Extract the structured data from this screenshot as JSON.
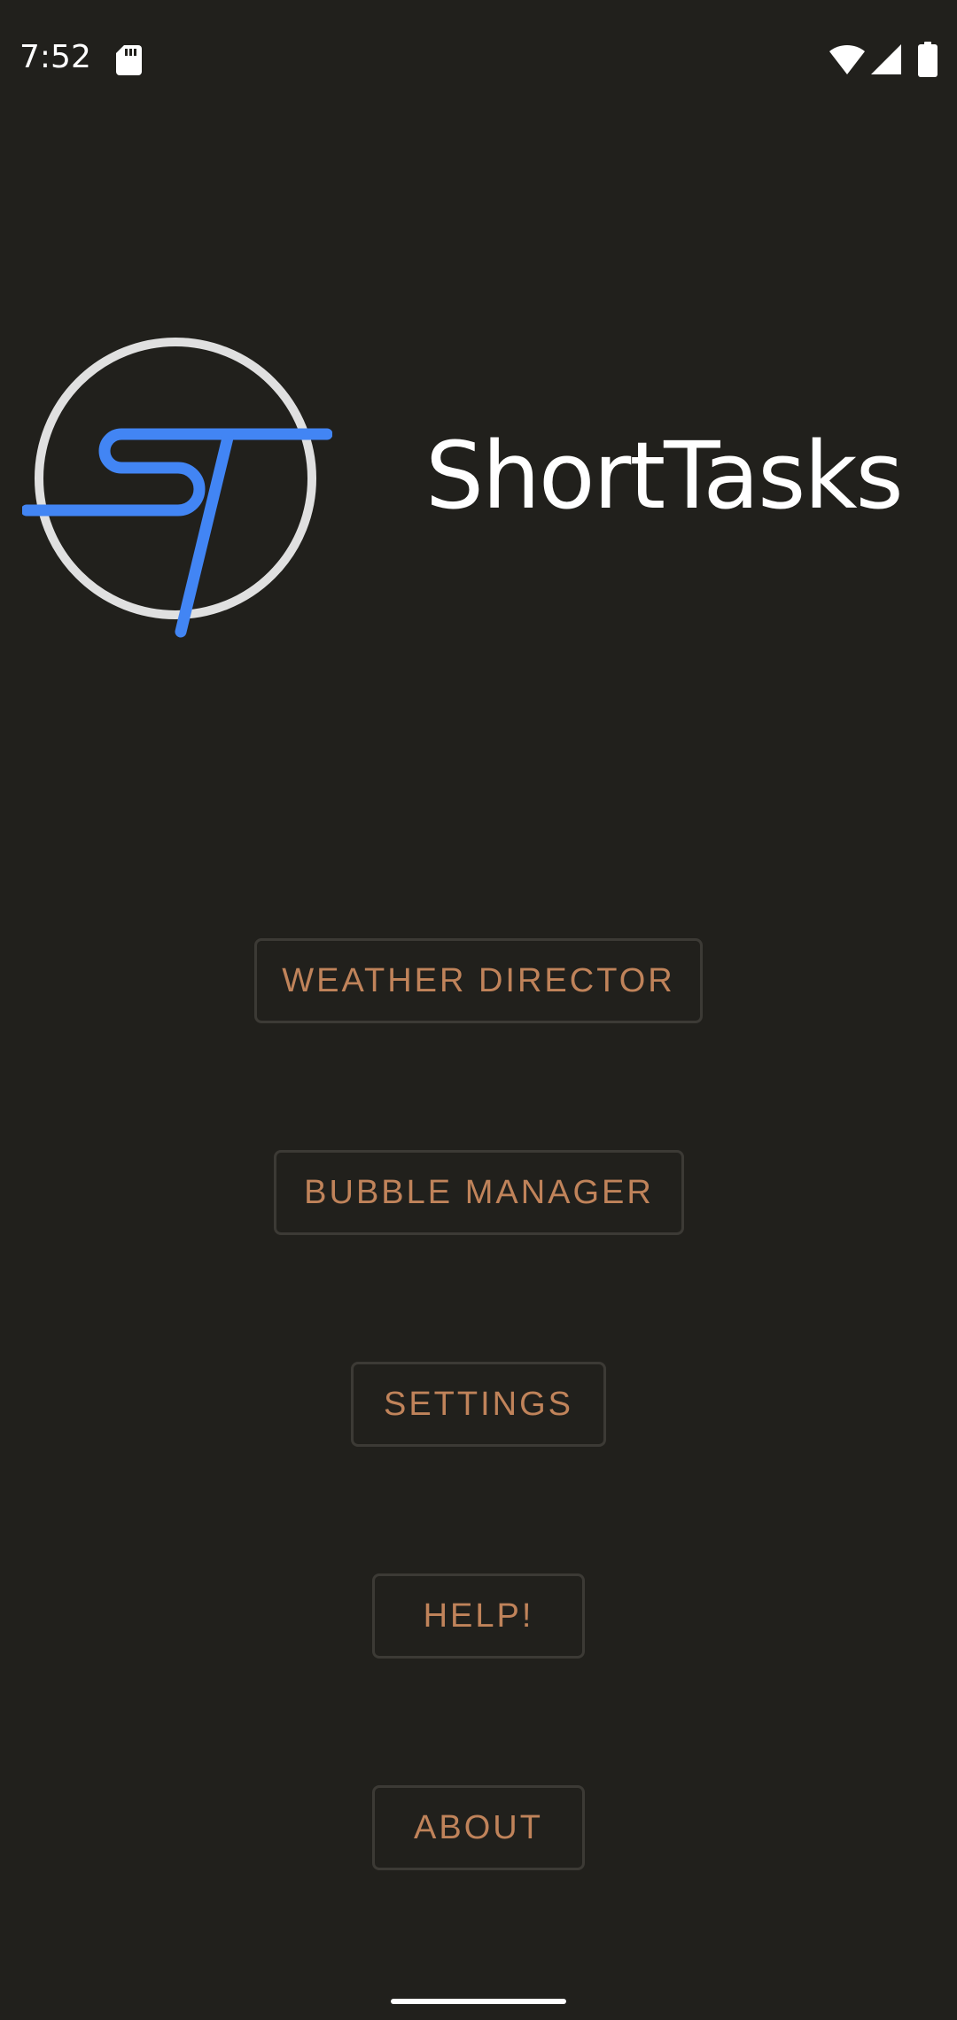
{
  "status_bar": {
    "time": "7:52",
    "icons": [
      "sd-card-icon",
      "wifi-icon",
      "signal-icon",
      "battery-icon"
    ]
  },
  "app": {
    "title": "ShortTasks",
    "logo_icon": "shorttasks-logo-icon"
  },
  "menu": {
    "weather_director": "WEATHER DIRECTOR",
    "bubble_manager": "BUBBLE MANAGER",
    "settings": "SETTINGS",
    "help": "HELP!",
    "about": "ABOUT"
  },
  "colors": {
    "background": "#21201c",
    "button_text": "#c0835a",
    "button_border": "#3c3a35",
    "logo_circle": "#e0e0e0",
    "logo_letters": "#4285f4"
  }
}
